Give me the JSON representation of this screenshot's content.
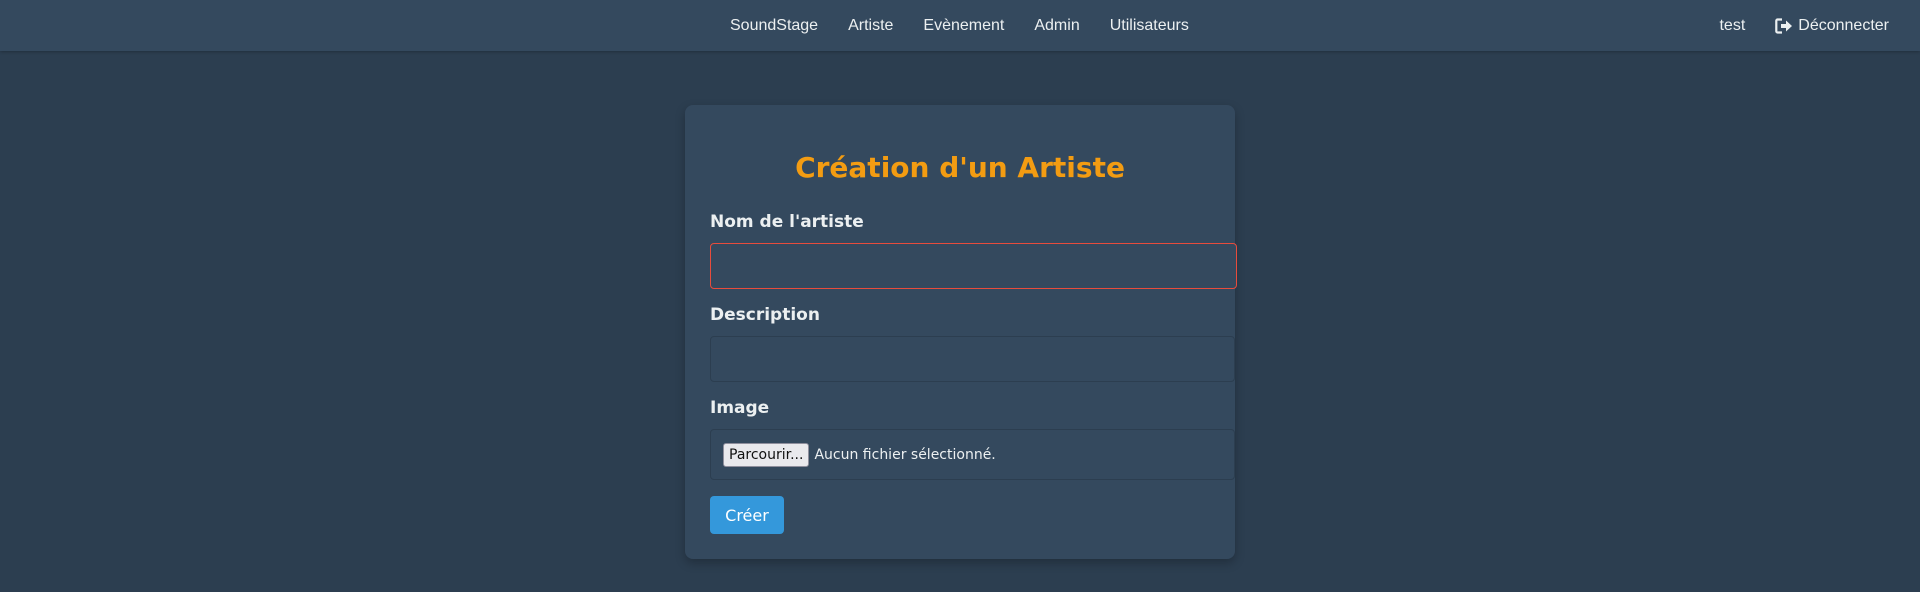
{
  "navbar": {
    "links": [
      {
        "label": "SoundStage"
      },
      {
        "label": "Artiste"
      },
      {
        "label": "Evènement"
      },
      {
        "label": "Admin"
      },
      {
        "label": "Utilisateurs"
      }
    ],
    "username": "test",
    "logout_label": "Déconnecter"
  },
  "form": {
    "title": "Création d'un Artiste",
    "name_label": "Nom de l'artiste",
    "name_value": "",
    "description_label": "Description",
    "description_value": "",
    "image_label": "Image",
    "file_button_label": "Parcourir...",
    "file_status": "Aucun fichier sélectionné.",
    "submit_label": "Créer"
  },
  "colors": {
    "background": "#2c3e50",
    "panel": "#34495e",
    "title_accent": "#f39c12",
    "button": "#3498db",
    "invalid_border": "#e74c3c"
  },
  "icons": {
    "logout": "sign-out-icon"
  }
}
